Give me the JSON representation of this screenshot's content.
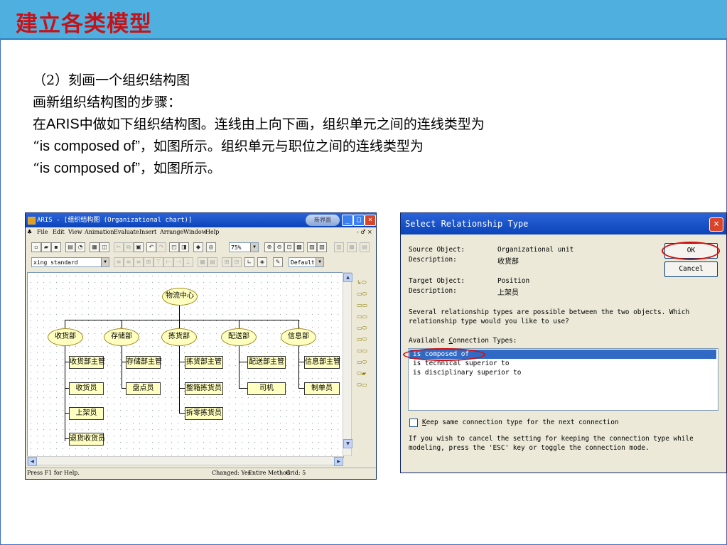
{
  "slide": {
    "title": "建立各类模型",
    "lines": [
      {
        "pre": "（2）刻画一个组织结构图",
        "en": "",
        "post": ""
      },
      {
        "pre": "画新组织结构图的步骤：",
        "en": "",
        "post": ""
      },
      {
        "pre": "在",
        "en": "ARIS",
        "post": "中做如下组织结构图。连线由上向下画，组织单元之间的连线类型为"
      },
      {
        "pre": "“",
        "en": "is composed of”",
        "post": "，如图所示。组织单元与职位之间的连线类型为"
      },
      {
        "pre": "“",
        "en": "is composed of”",
        "post": "，如图所示。"
      }
    ]
  },
  "aris_window": {
    "title": "ARIS - [组织结构图 (Organizational chart)]",
    "logo_text": "新界面",
    "menu": [
      "File",
      "Edit",
      "View",
      "Animation",
      "Evaluate",
      "Insert",
      "Arrange",
      "Window",
      "Help"
    ],
    "menu_right": "- ♂ ×",
    "zoom": "75%",
    "style_combo": "xing standard",
    "default_combo": "Default",
    "status_help": "Press F1 for Help.",
    "status_changed": "Changed: Yes",
    "status_method": "Entire Method",
    "status_grid": "Grid: 5",
    "nodes": {
      "root": "物流中心",
      "units": [
        "收货部",
        "存储部",
        "拣货部",
        "配送部",
        "信息部"
      ],
      "positions": {
        "shouhuo": [
          "收货部主管",
          "收货员",
          "上架员",
          "退货收货员"
        ],
        "cunchu": [
          "存储部主管",
          "盘点员"
        ],
        "jianhuo": [
          "拣货部主管",
          "整箱拣货员",
          "拆零拣货员"
        ],
        "peisong": [
          "配送部主管",
          "司机"
        ],
        "xinxi": [
          "信息部主管",
          "制单员"
        ]
      }
    }
  },
  "dialog": {
    "title": "Select Relationship Type",
    "source_object_label": "Source Object:",
    "source_object_value": "Organizational unit",
    "source_desc_label": "Description:",
    "source_desc_value": "收货部",
    "target_object_label": "Target Object:",
    "target_object_value": "Position",
    "target_desc_label": "Description:",
    "target_desc_value": "上架员",
    "message_1": "Several relationship types are possible between the two objects. Which",
    "message_2": "relationship type would you like to use?",
    "available_prefix": "Available ",
    "available_underlined": "C",
    "available_suffix": "onnection Types:",
    "connection_types": [
      "is composed of",
      "is technical superior to",
      "is disciplinary superior to"
    ],
    "keep_prefix": "",
    "keep_underlined": "K",
    "keep_suffix": "eep same connection type for the next connection",
    "info_1": "If you wish to cancel the setting for keeping the connection type while",
    "info_2": "modeling, press the 'ESC' key or toggle the connection mode.",
    "ok_label": "OK",
    "cancel_label": "Cancel"
  }
}
